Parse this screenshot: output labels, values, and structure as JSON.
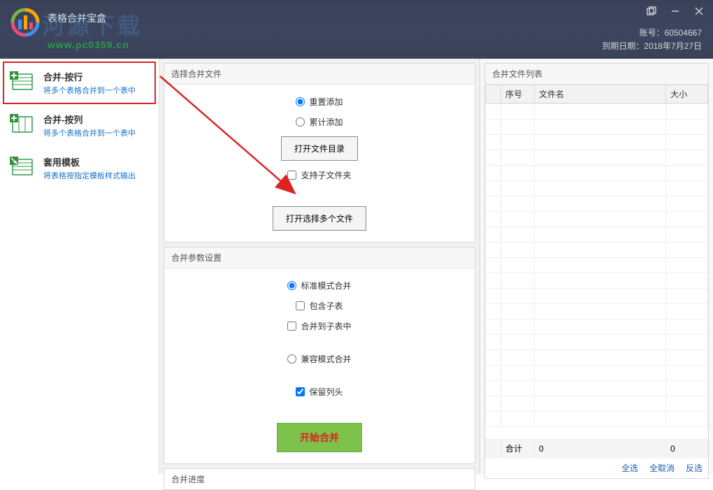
{
  "titlebar": {
    "app_title": "表格合并宝盒",
    "watermark_text": "河源下载",
    "watermark_url": "www.pc0359.cn",
    "account_label": "账号：",
    "account_value": "60504667",
    "expire_label": "到期日期：",
    "expire_value": "2018年7月27日"
  },
  "sidebar": {
    "items": [
      {
        "title": "合并-按行",
        "desc": "将多个表格合并到一个表中"
      },
      {
        "title": "合并-按列",
        "desc": "将多个表格合并到一个表中"
      },
      {
        "title": "套用模板",
        "desc": "将表格按指定模板样式输出"
      }
    ]
  },
  "center": {
    "select_files_title": "选择合并文件",
    "radio_reset": "重置添加",
    "radio_accumulate": "累计添加",
    "btn_open_dir": "打开文件目录",
    "check_support_subfolder": "支持子文件夹",
    "btn_open_multiple": "打开选择多个文件",
    "params_title": "合并参数设置",
    "radio_standard": "标准模式合并",
    "check_include_sub": "包含子表",
    "check_merge_to_sub": "合并到子表中",
    "radio_compat": "兼容模式合并",
    "check_keep_header": "保留列头",
    "btn_start": "开始合并",
    "progress_label": "合并进度"
  },
  "right": {
    "list_title": "合并文件列表",
    "col_seq": "序号",
    "col_name": "文件名",
    "col_size": "大小",
    "total_label": "合计",
    "total_count": "0",
    "total_size": "0",
    "select_all": "全选",
    "deselect_all": "全取消",
    "invert": "反选"
  }
}
